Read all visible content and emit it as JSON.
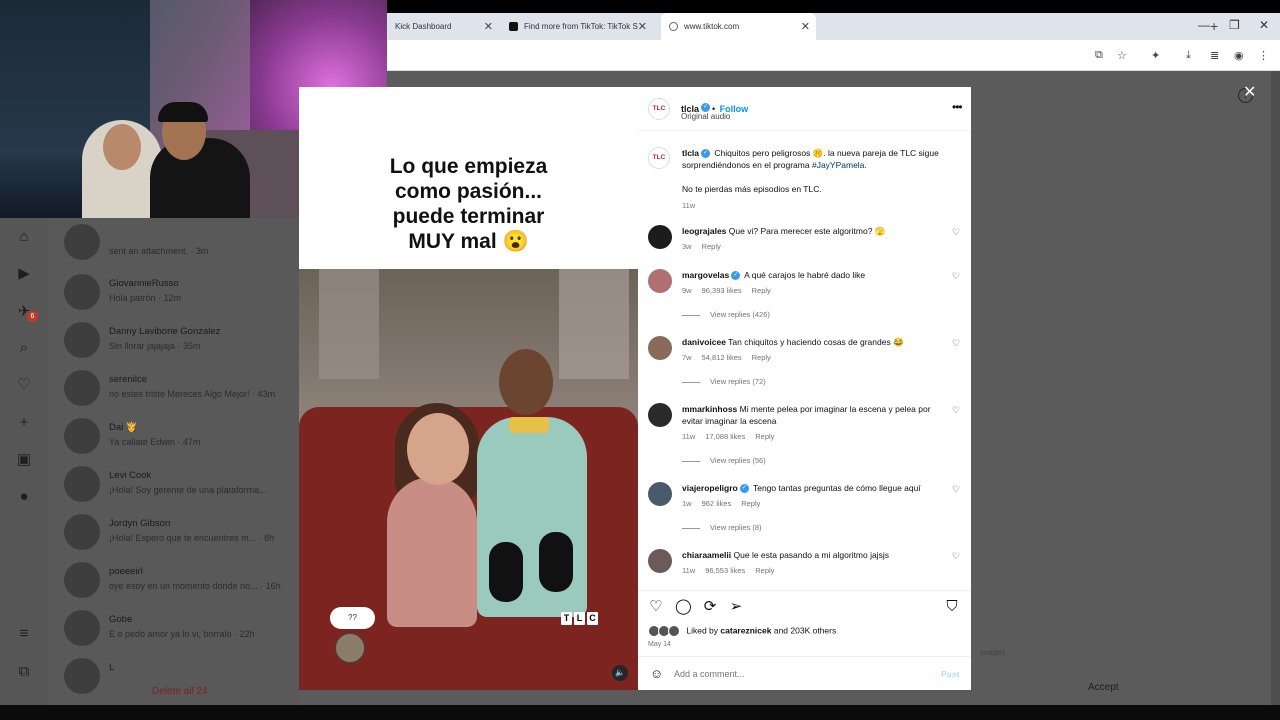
{
  "browser": {
    "tabs": [
      {
        "label": "Kick Dashboard"
      },
      {
        "label": "Find more from TikTok: TikTok S"
      },
      {
        "label": "www.tiktok.com"
      }
    ],
    "new_tab": "+",
    "win_min": "—",
    "win_max": "❐",
    "win_close": "✕"
  },
  "backdrop": {
    "rail_badge": "6",
    "dms": [
      {
        "name": "",
        "preview": "sent an attachment. · 3m"
      },
      {
        "name": "GiovannieRusso",
        "preview": "Hola patrón · 12m"
      },
      {
        "name": "Danny Laviborie Gonzalez",
        "preview": "Sin llorar jajajaja · 35m"
      },
      {
        "name": "serenilce",
        "preview": "no estes triste Mereces Algo Mejor! ·  43m"
      },
      {
        "name": "Dai 👸",
        "preview": "Ya callate Edwin · 47m"
      },
      {
        "name": "Levi Cook",
        "preview": "¡Hola! Soy gerente de una plataforma..."
      },
      {
        "name": "Jordyn Gibson",
        "preview": "¡Hola! Espero que te encuentres m... · 8h"
      },
      {
        "name": "poeeeirl",
        "preview": "oye esoy en un momento donde no... · 16h"
      },
      {
        "name": "Gobe",
        "preview": "E o pedo amor ya lo vi, borralo · 22h"
      },
      {
        "name": "L",
        "preview": ""
      }
    ],
    "delete_all": "Delete all 24",
    "accept": "Accept",
    "right_msg": "ssages"
  },
  "media": {
    "caption_lines": [
      "Lo que empieza",
      "como pasión...",
      "puede terminar",
      "MUY mal 😮"
    ],
    "bubble": "??",
    "tlc_letters": [
      "T",
      "L",
      "C"
    ],
    "mute_icon": "🔈"
  },
  "post": {
    "author": "tlcla",
    "follow": "Follow",
    "audio": "Original audio",
    "logo_text": "TLC",
    "more": "•••",
    "caption": {
      "text_before": "Chiquitos pero peligrosos 🤫. la nueva pareja de TLC sigue sorprendiéndonos en el programa",
      "hashtag": "#JayYPamela",
      "text_after": ".",
      "line2": "No te pierdas más episodios en TLC.",
      "time": "11w"
    },
    "comments": [
      {
        "user": "leograjales",
        "text": "Que vi? Para merecer este algoritmo? 🫣",
        "time": "3w",
        "likes": "",
        "replies": ""
      },
      {
        "user": "margovelas",
        "text": "A qué carajos le habré dado like",
        "time": "9w",
        "likes": "96,393 likes",
        "replies": "View replies (426)"
      },
      {
        "user": "danivoicee",
        "text": "Tan chiquitos y haciendo cosas de grandes 😂",
        "time": "7w",
        "likes": "54,812 likes",
        "replies": "View replies (72)"
      },
      {
        "user": "mmarkinhoss",
        "text": "Mi mente pelea por imaginar la escena y pelea por evitar imaginar la escena",
        "time": "11w",
        "likes": "17,088 likes",
        "replies": "View replies (56)"
      },
      {
        "user": "viajeropeligro",
        "text": "Tengo tantas preguntas de cómo llegue aquí",
        "time": "1w",
        "likes": "962 likes",
        "replies": "View replies (8)"
      },
      {
        "user": "chiaraamelii",
        "text": "Que le esta pasando a mi algoritmo jajsjs",
        "time": "11w",
        "likes": "96,553 likes",
        "replies": ""
      }
    ],
    "reply_label": "Reply",
    "liked_by_prefix": "Liked by",
    "liked_by_user": "catareznicek",
    "liked_by_suffix": "and 203K others",
    "date": "May 14",
    "comment_placeholder": "Add a comment...",
    "post_label": "Post"
  },
  "overlay": {
    "close": "✕",
    "info": "i"
  }
}
